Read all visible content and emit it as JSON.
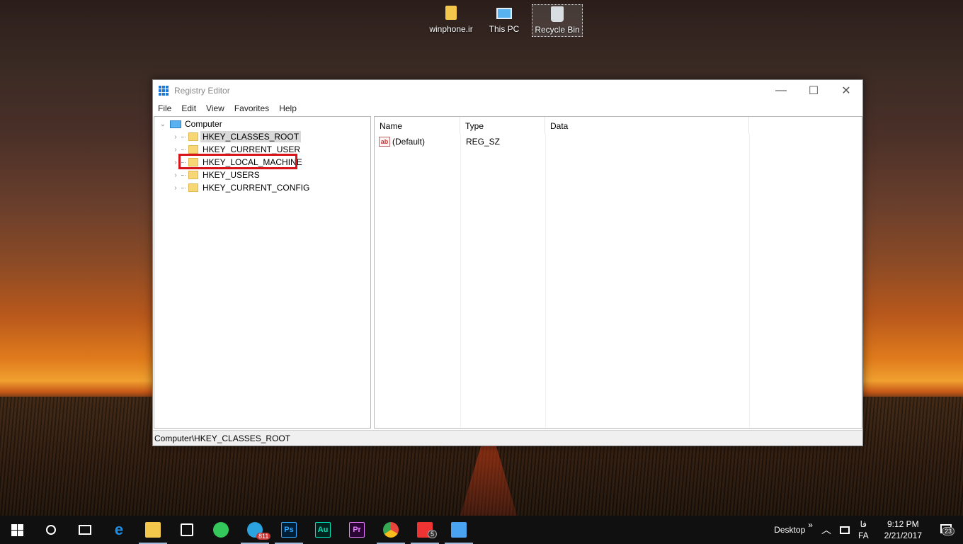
{
  "desktop": {
    "icons": [
      {
        "label": "winphone.ir",
        "icon": "folder-icon"
      },
      {
        "label": "This PC",
        "icon": "computer-icon"
      },
      {
        "label": "Recycle Bin",
        "icon": "recycle-bin-icon"
      }
    ]
  },
  "window": {
    "title": "Registry Editor",
    "controls": {
      "minimize": "—",
      "maximize": "☐",
      "close": "✕"
    },
    "menu": [
      "File",
      "Edit",
      "View",
      "Favorites",
      "Help"
    ],
    "tree": {
      "root": "Computer",
      "items": [
        "HKEY_CLASSES_ROOT",
        "HKEY_CURRENT_USER",
        "HKEY_LOCAL_MACHINE",
        "HKEY_USERS",
        "HKEY_CURRENT_CONFIG"
      ],
      "selected": "HKEY_CLASSES_ROOT",
      "highlighted_box": "HKEY_LOCAL_MACHINE"
    },
    "list": {
      "columns": [
        "Name",
        "Type",
        "Data"
      ],
      "rows": [
        {
          "name": "(Default)",
          "type": "REG_SZ",
          "data": ""
        }
      ]
    },
    "status": "Computer\\HKEY_CLASSES_ROOT"
  },
  "taskbar": {
    "apps": [
      {
        "name": "Edge",
        "label": "e",
        "color": "#1e90e6"
      },
      {
        "name": "File Explorer",
        "label": "",
        "color": "#f3c64c"
      },
      {
        "name": "Store",
        "label": "",
        "color": "#ffffff"
      },
      {
        "name": "WhatsApp",
        "label": "",
        "color": "#34c759"
      },
      {
        "name": "Telegram",
        "label": "",
        "color": "#2aa3e0",
        "badge": "811"
      },
      {
        "name": "Photoshop",
        "label": "Ps",
        "color": "#31a8ff"
      },
      {
        "name": "Audition",
        "label": "Au",
        "color": "#00e4bb"
      },
      {
        "name": "Premiere",
        "label": "Pr",
        "color": "#e77bff"
      },
      {
        "name": "Chrome",
        "label": "",
        "color": "#e8453c"
      },
      {
        "name": "App",
        "label": "",
        "color": "#e33",
        "badge": "5"
      },
      {
        "name": "App2",
        "label": "",
        "color": "#4aa3f0"
      }
    ],
    "tray": {
      "desktop_label": "Desktop",
      "chevrons": "»",
      "lang_top": "فا",
      "lang_bottom": "FA",
      "time": "9:12 PM",
      "date": "2/21/2017",
      "notifications": "23"
    }
  }
}
